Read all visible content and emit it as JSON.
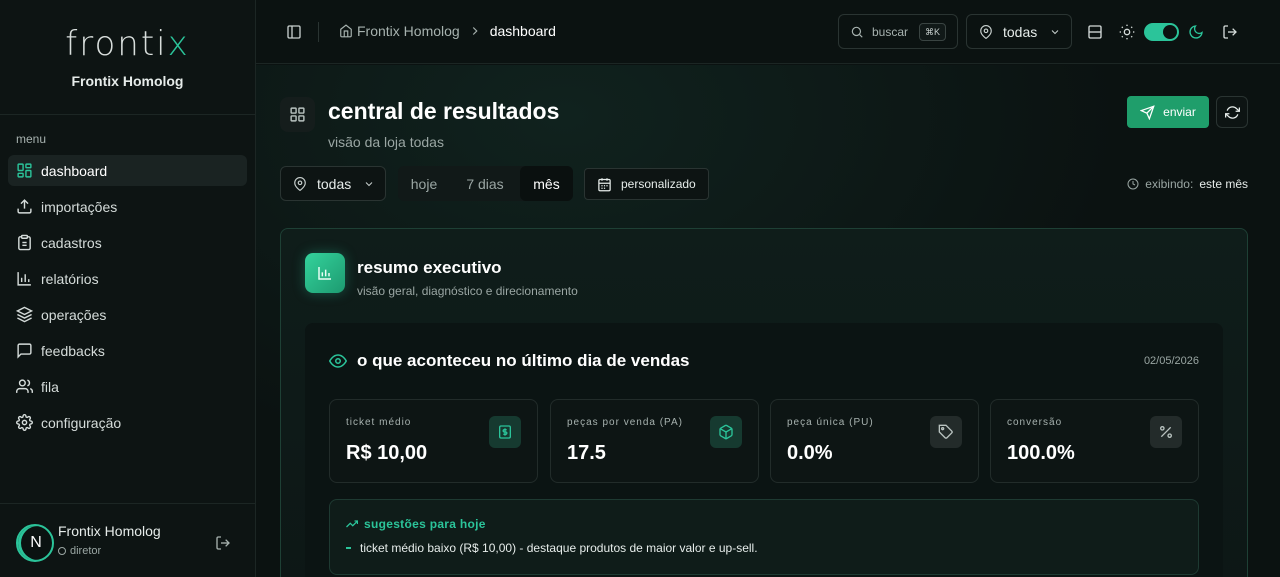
{
  "brand": {
    "logo_main": "fronti",
    "logo_accent": "x",
    "subtitle": "Frontix Homolog"
  },
  "sidebar": {
    "menu_label": "menu",
    "items": [
      {
        "label": "dashboard",
        "icon": "grid-icon",
        "active": true
      },
      {
        "label": "importações",
        "icon": "upload-icon"
      },
      {
        "label": "cadastros",
        "icon": "clipboard-icon"
      },
      {
        "label": "relatórios",
        "icon": "bar-chart-icon"
      },
      {
        "label": "operações",
        "icon": "layers-icon"
      },
      {
        "label": "feedbacks",
        "icon": "message-icon"
      },
      {
        "label": "fila",
        "icon": "users-icon"
      },
      {
        "label": "configuração",
        "icon": "gear-icon"
      }
    ],
    "user": {
      "initial": "N",
      "name": "Frontix Homolog",
      "role": "diretor"
    }
  },
  "header": {
    "breadcrumb": {
      "home": "Frontix Homolog",
      "current": "dashboard"
    },
    "search": {
      "placeholder": "buscar",
      "shortcut": "⌘K"
    },
    "store_select": "todas",
    "theme_dark": true
  },
  "page": {
    "title": "central de resultados",
    "subtitle": "visão da loja todas",
    "send_label": "enviar",
    "filters": {
      "store": "todas",
      "periods": [
        "hoje",
        "7 dias",
        "mês"
      ],
      "active_period": "mês",
      "custom_label": "personalizado",
      "showing_label": "exibindo:",
      "showing_value": "este mês"
    }
  },
  "executive": {
    "title": "resumo executivo",
    "subtitle": "visão geral, diagnóstico e direcionamento",
    "day": {
      "title": "o que aconteceu no último dia de vendas",
      "date": "02/05/2026",
      "metrics": [
        {
          "label": "ticket médio",
          "value": "R$ 10,00",
          "icon": "dollar-icon",
          "tone": "green"
        },
        {
          "label": "peças por venda (PA)",
          "value": "17.5",
          "icon": "box-icon",
          "tone": "green"
        },
        {
          "label": "peça única (PU)",
          "value": "0.0%",
          "icon": "tag-icon",
          "tone": "gray"
        },
        {
          "label": "conversão",
          "value": "100.0%",
          "icon": "percent-icon",
          "tone": "gray"
        }
      ],
      "suggestions": {
        "title": "sugestões para hoje",
        "items": [
          "ticket médio baixo (R$ 10,00) - destaque produtos de maior valor e up-sell."
        ]
      }
    }
  }
}
